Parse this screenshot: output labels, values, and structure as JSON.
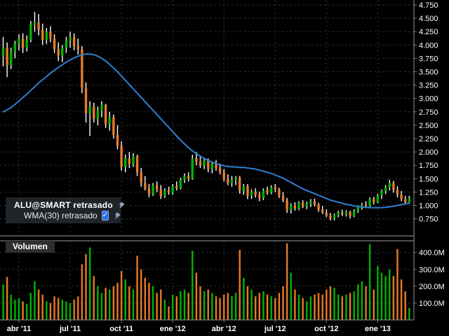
{
  "ui": {
    "legend": {
      "title": "ALU@SMART retrasado",
      "wma_label": "WMA(30) retrasado",
      "wma_checked": true
    },
    "volume_label": "Volumen",
    "icons": {
      "hand": "☛",
      "check": "✓"
    }
  },
  "colors": {
    "background": "#000000",
    "up": "#00b400",
    "down": "#e87a25",
    "wick": "#ffffff",
    "wma": "#2e7fd0",
    "grid": "#3a3a3a",
    "border": "#7d7d7d",
    "text": "#ffffff"
  },
  "chart_data": {
    "type": "candlestick",
    "title": "ALU@SMART retrasado",
    "legend_position": "left-middle",
    "grid": true,
    "x_axis": {
      "tick_labels": [
        "abr '11",
        "jul '11",
        "oct '11",
        "ene '12",
        "abr '12",
        "jul '12",
        "oct '12",
        "ene '13"
      ],
      "tick_weeks": [
        4,
        17,
        30,
        43,
        56,
        69,
        82,
        95
      ]
    },
    "price_axis": {
      "tick_values": [
        4.75,
        4.5,
        4.25,
        4.0,
        3.75,
        3.5,
        3.25,
        3.0,
        2.75,
        2.5,
        2.25,
        2.0,
        1.75,
        1.5,
        1.25,
        1.0,
        0.75
      ],
      "decimals": 3,
      "side": "right"
    },
    "volume_axis": {
      "tick_labels": [
        "400.0M",
        "300.0M",
        "200.0M",
        "100.0M"
      ],
      "tick_values": [
        400,
        300,
        200,
        100
      ],
      "unit": "millions"
    },
    "series": [
      {
        "name": "ALU@SMART retrasado",
        "type": "ohlcv_weekly",
        "note": "columns: open, high, low, close, volume_millions",
        "ohlcv": [
          [
            3.8,
            4.15,
            3.6,
            3.95,
            210
          ],
          [
            3.95,
            4.05,
            3.4,
            3.62,
            255
          ],
          [
            3.62,
            3.95,
            3.55,
            3.88,
            150
          ],
          [
            3.88,
            4.08,
            3.75,
            4.02,
            120
          ],
          [
            4.02,
            4.2,
            3.9,
            4.12,
            130
          ],
          [
            4.12,
            4.22,
            3.85,
            3.95,
            110
          ],
          [
            3.95,
            4.18,
            3.88,
            4.1,
            95
          ],
          [
            4.1,
            4.45,
            4.05,
            4.38,
            160
          ],
          [
            4.38,
            4.62,
            4.25,
            4.42,
            230
          ],
          [
            4.42,
            4.58,
            4.18,
            4.28,
            180
          ],
          [
            4.28,
            4.4,
            4.0,
            4.1,
            150
          ],
          [
            4.1,
            4.32,
            4.02,
            4.25,
            110
          ],
          [
            4.25,
            4.35,
            4.05,
            4.12,
            100
          ],
          [
            4.12,
            4.2,
            3.85,
            3.92,
            140
          ],
          [
            3.92,
            4.05,
            3.7,
            3.8,
            130
          ],
          [
            3.8,
            4.0,
            3.68,
            3.95,
            120
          ],
          [
            3.95,
            4.15,
            3.85,
            4.08,
            110
          ],
          [
            4.08,
            4.25,
            3.95,
            4.15,
            100
          ],
          [
            4.15,
            4.22,
            3.9,
            3.98,
            120
          ],
          [
            3.98,
            4.12,
            3.82,
            3.92,
            140
          ],
          [
            3.92,
            3.98,
            3.1,
            3.2,
            330
          ],
          [
            3.2,
            3.3,
            2.55,
            2.72,
            390
          ],
          [
            2.72,
            2.95,
            2.3,
            2.85,
            430
          ],
          [
            2.85,
            2.92,
            2.55,
            2.62,
            260
          ],
          [
            2.62,
            2.85,
            2.5,
            2.78,
            200
          ],
          [
            2.78,
            2.95,
            2.65,
            2.88,
            160
          ],
          [
            2.88,
            2.9,
            2.45,
            2.52,
            190
          ],
          [
            2.52,
            2.75,
            2.4,
            2.65,
            180
          ],
          [
            2.65,
            2.7,
            2.25,
            2.32,
            200
          ],
          [
            2.32,
            2.5,
            2.05,
            2.12,
            220
          ],
          [
            2.12,
            2.2,
            1.65,
            1.72,
            290
          ],
          [
            1.72,
            1.95,
            1.62,
            1.88,
            240
          ],
          [
            1.88,
            2.0,
            1.7,
            1.78,
            200
          ],
          [
            1.78,
            1.98,
            1.72,
            1.92,
            180
          ],
          [
            1.92,
            1.95,
            1.55,
            1.62,
            380
          ],
          [
            1.62,
            1.7,
            1.35,
            1.42,
            300
          ],
          [
            1.42,
            1.55,
            1.28,
            1.32,
            250
          ],
          [
            1.32,
            1.4,
            1.15,
            1.22,
            220
          ],
          [
            1.22,
            1.42,
            1.18,
            1.38,
            200
          ],
          [
            1.38,
            1.45,
            1.25,
            1.3,
            160
          ],
          [
            1.3,
            1.38,
            1.12,
            1.18,
            180
          ],
          [
            1.18,
            1.32,
            1.14,
            1.28,
            120
          ],
          [
            1.28,
            1.35,
            1.2,
            1.24,
            80
          ],
          [
            1.24,
            1.4,
            1.2,
            1.36,
            150
          ],
          [
            1.36,
            1.45,
            1.28,
            1.32,
            140
          ],
          [
            1.32,
            1.52,
            1.3,
            1.48,
            170
          ],
          [
            1.48,
            1.6,
            1.42,
            1.55,
            180
          ],
          [
            1.55,
            1.62,
            1.45,
            1.5,
            160
          ],
          [
            1.5,
            1.95,
            1.48,
            1.88,
            410
          ],
          [
            1.88,
            2.0,
            1.75,
            1.82,
            280
          ],
          [
            1.82,
            1.92,
            1.7,
            1.75,
            200
          ],
          [
            1.75,
            1.88,
            1.68,
            1.84,
            170
          ],
          [
            1.84,
            1.88,
            1.62,
            1.68,
            180
          ],
          [
            1.68,
            1.82,
            1.6,
            1.78,
            160
          ],
          [
            1.78,
            1.85,
            1.65,
            1.7,
            140
          ],
          [
            1.7,
            1.78,
            1.58,
            1.62,
            130
          ],
          [
            1.62,
            1.68,
            1.45,
            1.5,
            150
          ],
          [
            1.5,
            1.58,
            1.38,
            1.42,
            160
          ],
          [
            1.42,
            1.55,
            1.35,
            1.48,
            140
          ],
          [
            1.48,
            1.55,
            1.38,
            1.52,
            160
          ],
          [
            1.52,
            1.55,
            1.22,
            1.28,
            415
          ],
          [
            1.28,
            1.4,
            1.2,
            1.36,
            250
          ],
          [
            1.36,
            1.4,
            1.12,
            1.18,
            200
          ],
          [
            1.18,
            1.3,
            1.12,
            1.26,
            180
          ],
          [
            1.26,
            1.32,
            1.15,
            1.2,
            140
          ],
          [
            1.2,
            1.26,
            1.08,
            1.14,
            160
          ],
          [
            1.14,
            1.32,
            1.1,
            1.28,
            170
          ],
          [
            1.28,
            1.35,
            1.2,
            1.24,
            150
          ],
          [
            1.24,
            1.38,
            1.21,
            1.34,
            140
          ],
          [
            1.34,
            1.4,
            1.25,
            1.3,
            130
          ],
          [
            1.3,
            1.33,
            1.14,
            1.18,
            160
          ],
          [
            1.18,
            1.25,
            1.06,
            1.1,
            200
          ],
          [
            1.1,
            1.14,
            0.86,
            0.92,
            455
          ],
          [
            0.92,
            1.04,
            0.85,
            1.0,
            280
          ],
          [
            1.0,
            1.06,
            0.9,
            0.94,
            180
          ],
          [
            0.94,
            1.08,
            0.91,
            1.05,
            150
          ],
          [
            1.05,
            1.1,
            0.95,
            0.98,
            130
          ],
          [
            0.98,
            1.07,
            0.93,
            1.03,
            110
          ],
          [
            1.03,
            1.12,
            0.97,
            1.08,
            140
          ],
          [
            1.08,
            1.13,
            0.98,
            1.01,
            150
          ],
          [
            1.01,
            1.05,
            0.88,
            0.92,
            160
          ],
          [
            0.92,
            0.99,
            0.84,
            0.87,
            150
          ],
          [
            0.87,
            0.93,
            0.78,
            0.81,
            180
          ],
          [
            0.81,
            0.86,
            0.72,
            0.76,
            200
          ],
          [
            0.76,
            0.85,
            0.72,
            0.82,
            190
          ],
          [
            0.82,
            0.9,
            0.78,
            0.87,
            150
          ],
          [
            0.87,
            0.92,
            0.8,
            0.84,
            140
          ],
          [
            0.84,
            0.91,
            0.79,
            0.88,
            150
          ],
          [
            0.88,
            0.9,
            0.76,
            0.8,
            160
          ],
          [
            0.8,
            0.93,
            0.78,
            0.9,
            170
          ],
          [
            0.9,
            1.0,
            0.86,
            0.97,
            210
          ],
          [
            0.97,
            1.05,
            0.92,
            1.01,
            230
          ],
          [
            1.01,
            1.08,
            0.95,
            0.99,
            200
          ],
          [
            0.99,
            1.15,
            0.97,
            1.12,
            450
          ],
          [
            1.12,
            1.16,
            1.02,
            1.06,
            180
          ],
          [
            1.06,
            1.22,
            1.04,
            1.19,
            320
          ],
          [
            1.19,
            1.3,
            1.12,
            1.27,
            280
          ],
          [
            1.27,
            1.38,
            1.21,
            1.34,
            260
          ],
          [
            1.34,
            1.48,
            1.28,
            1.42,
            300
          ],
          [
            1.42,
            1.46,
            1.24,
            1.29,
            260
          ],
          [
            1.29,
            1.36,
            1.15,
            1.2,
            420
          ],
          [
            1.2,
            1.27,
            1.08,
            1.12,
            240
          ],
          [
            1.12,
            1.18,
            1.02,
            1.06,
            170
          ],
          [
            1.06,
            1.18,
            1.03,
            1.14,
            70
          ]
        ]
      },
      {
        "name": "WMA(30) retrasado",
        "type": "line",
        "color": "#2e7fd0",
        "values": [
          2.75,
          2.79,
          2.83,
          2.89,
          2.95,
          3.02,
          3.08,
          3.15,
          3.22,
          3.29,
          3.35,
          3.41,
          3.47,
          3.53,
          3.58,
          3.63,
          3.68,
          3.72,
          3.76,
          3.79,
          3.82,
          3.83,
          3.83,
          3.82,
          3.79,
          3.75,
          3.7,
          3.64,
          3.57,
          3.5,
          3.42,
          3.34,
          3.26,
          3.18,
          3.1,
          3.02,
          2.94,
          2.86,
          2.78,
          2.7,
          2.62,
          2.54,
          2.46,
          2.38,
          2.3,
          2.22,
          2.15,
          2.08,
          2.02,
          1.97,
          1.92,
          1.88,
          1.84,
          1.81,
          1.78,
          1.76,
          1.74,
          1.73,
          1.72,
          1.72,
          1.71,
          1.71,
          1.7,
          1.69,
          1.68,
          1.66,
          1.64,
          1.62,
          1.6,
          1.57,
          1.54,
          1.51,
          1.47,
          1.43,
          1.39,
          1.35,
          1.31,
          1.28,
          1.25,
          1.22,
          1.19,
          1.16,
          1.13,
          1.1,
          1.08,
          1.06,
          1.04,
          1.02,
          1.01,
          0.99,
          0.98,
          0.97,
          0.965,
          0.96,
          0.958,
          0.958,
          0.96,
          0.965,
          0.975,
          0.985,
          1.0,
          1.015,
          1.03,
          1.045
        ]
      }
    ],
    "volume_panel": {
      "label": "Volumen",
      "bar_colors": "green up / orange down"
    }
  }
}
